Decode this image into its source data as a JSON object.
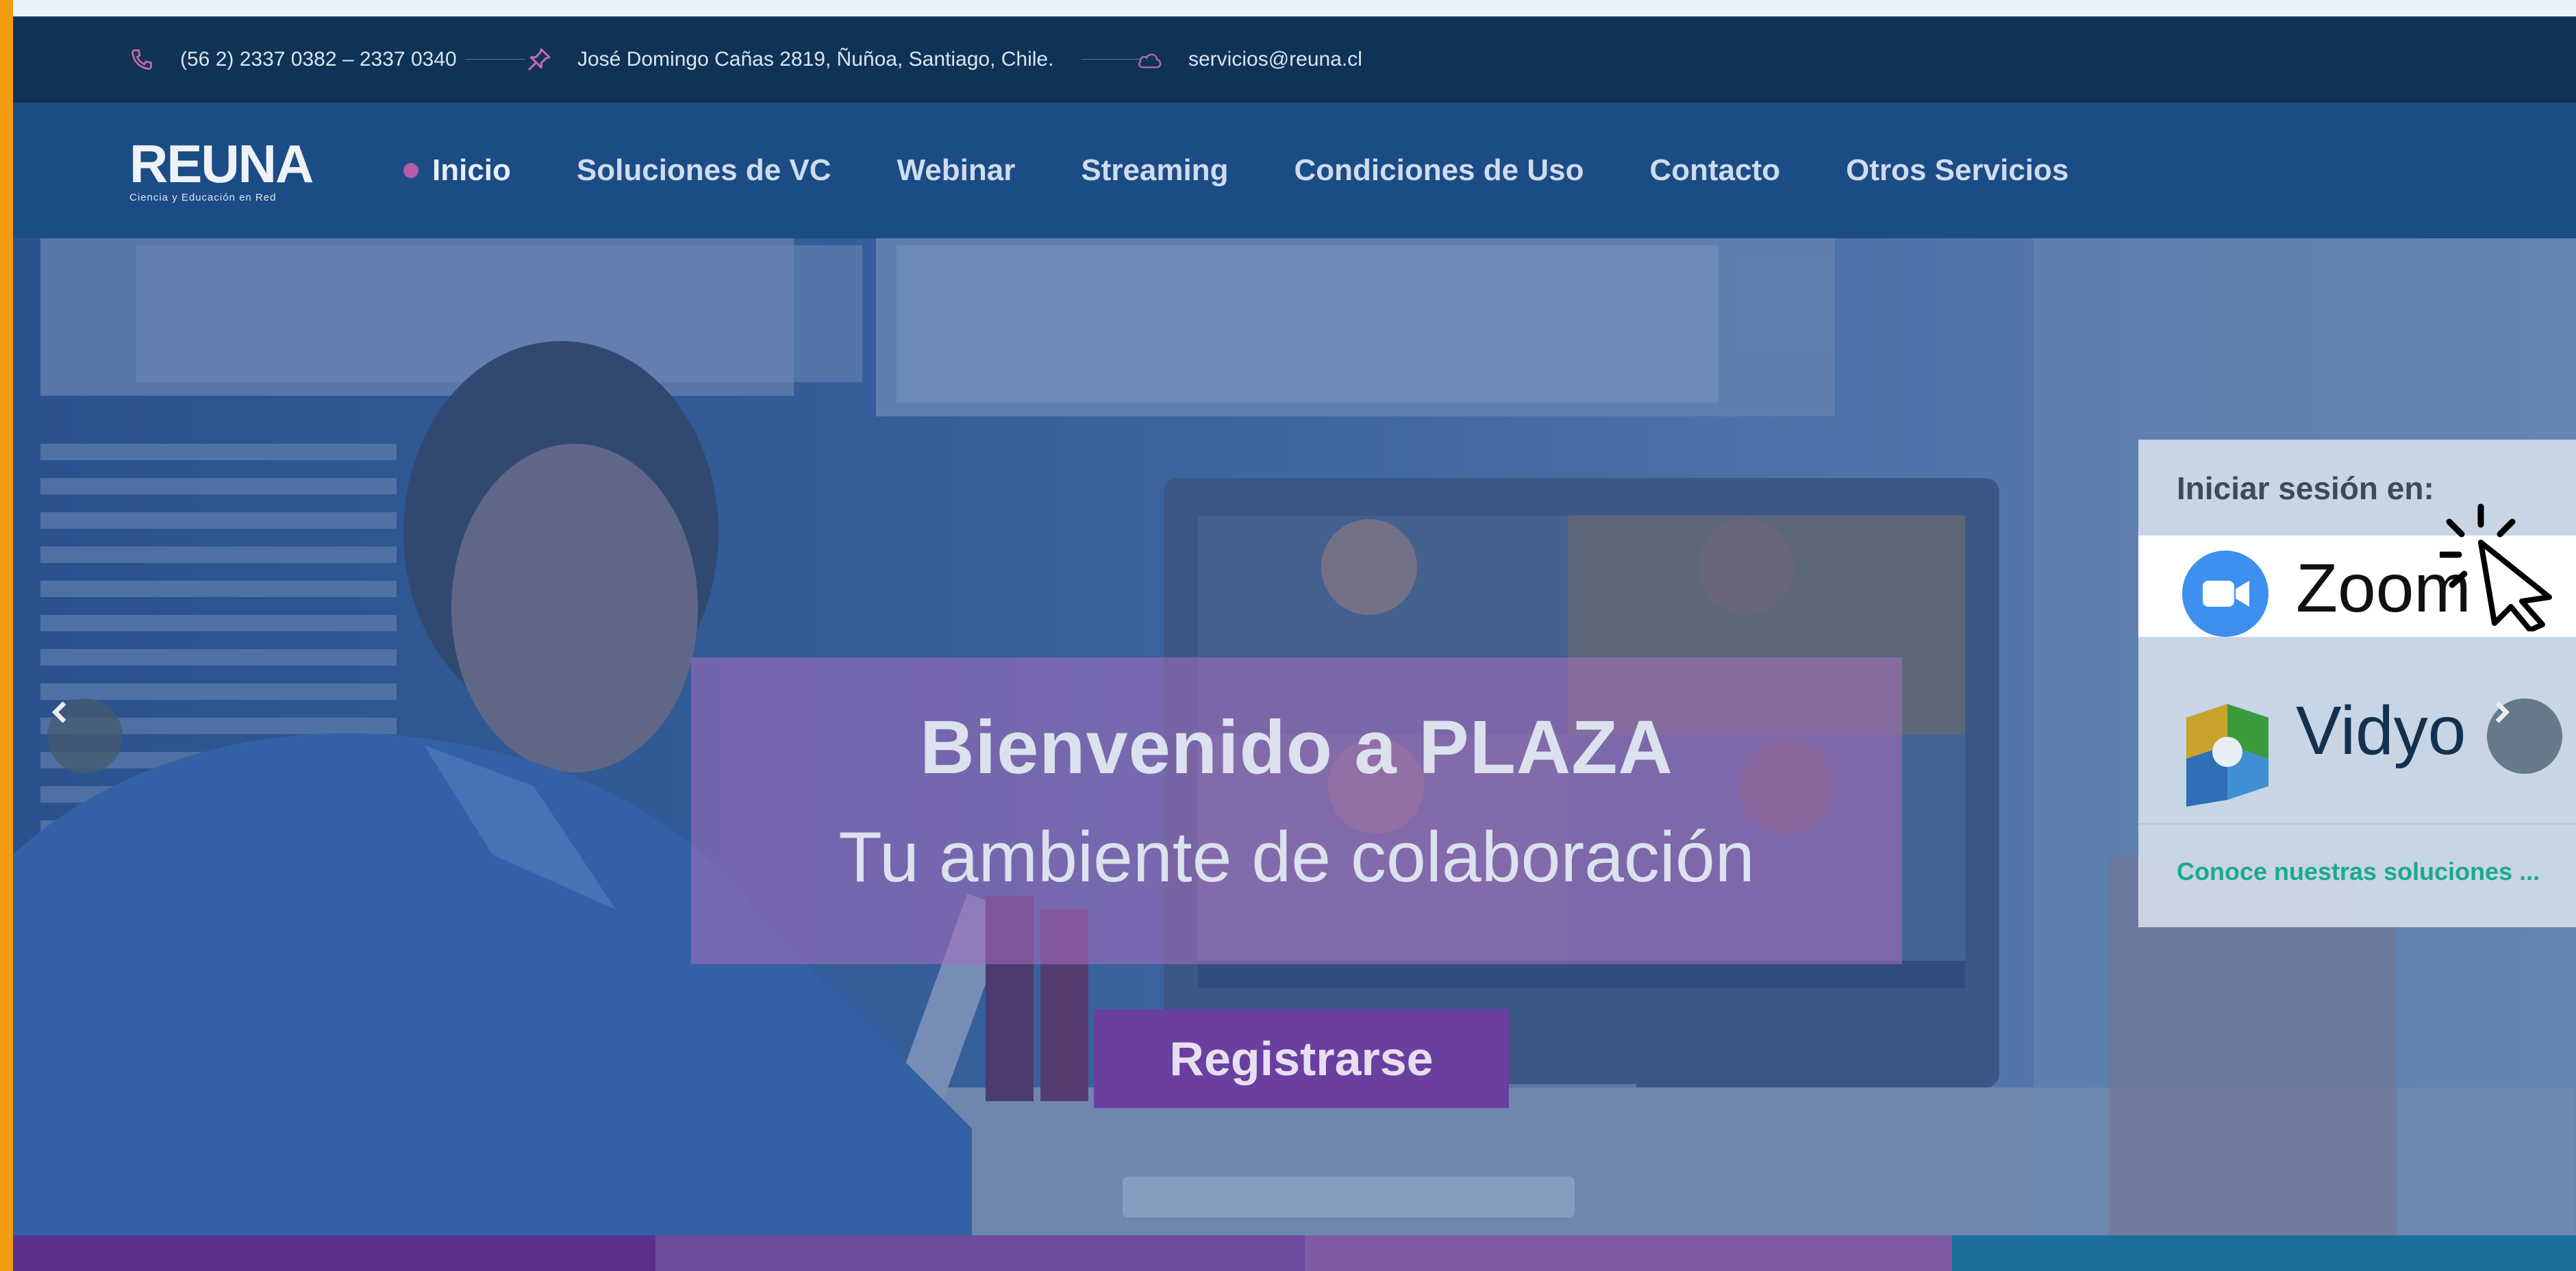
{
  "colors": {
    "accent": "#f39c12",
    "topbar": "#0f3357",
    "navbar": "#1b4c86",
    "register": "#6a3fa0",
    "link": "#1ba98f"
  },
  "contact": {
    "phone": "(56 2) 2337 0382 – 2337 0340",
    "address": "José Domingo Cañas 2819, Ñuñoa, Santiago, Chile.",
    "email": "servicios@reuna.cl"
  },
  "logo": {
    "mark": "REUNA",
    "tagline": "Ciencia y Educación en Red"
  },
  "nav": {
    "items": [
      {
        "label": "Inicio",
        "active": true
      },
      {
        "label": "Soluciones de VC"
      },
      {
        "label": "Webinar"
      },
      {
        "label": "Streaming"
      },
      {
        "label": "Condiciones de Uso"
      },
      {
        "label": "Contacto"
      },
      {
        "label": "Otros Servicios"
      }
    ]
  },
  "hero": {
    "title": "Bienvenido a PLAZA",
    "subtitle": "Tu ambiente de colaboración",
    "register_label": "Registrarse"
  },
  "login": {
    "label": "Iniciar sesión en:",
    "zoom": "Zoom",
    "vidyo": "Vidyo",
    "more_link": "Conoce nuestras soluciones ..."
  },
  "icons": [
    "phone-icon",
    "pin-icon",
    "cloud-icon",
    "chevron-left-icon",
    "chevron-right-icon",
    "pointer-cursor-icon",
    "zoom-logo-icon",
    "vidyo-logo-icon"
  ],
  "bottom_strip_colors": [
    "#5c2f8a",
    "#6e4a9c",
    "#7d5aa2",
    "#1b6e9c"
  ]
}
